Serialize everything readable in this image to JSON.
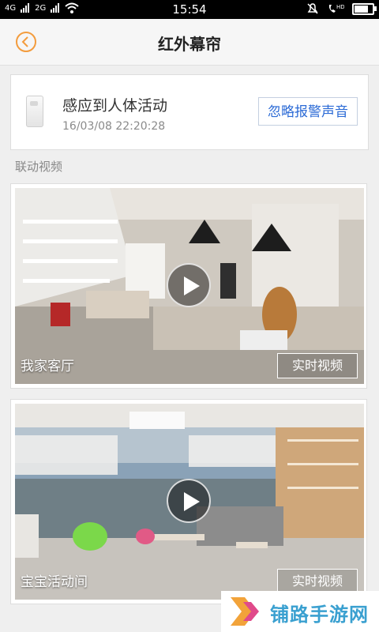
{
  "status_bar": {
    "signal_1": "4G",
    "signal_2": "2G",
    "time": "15:54",
    "battery_level": 0.85
  },
  "header": {
    "title": "红外幕帘"
  },
  "alert": {
    "title": "感应到人体活动",
    "time": "16/03/08 22:20:28",
    "mute_label": "忽略报警声音"
  },
  "section_label": "联动视频",
  "videos": [
    {
      "name": "我家客厅",
      "button": "实时视频"
    },
    {
      "name": "宝宝活动间",
      "button": "实时视频"
    }
  ],
  "watermark": {
    "text": "铺路手游网"
  },
  "colors": {
    "accent": "#f39c3d",
    "link": "#2c6bd6",
    "watermark": "#3aa0d0"
  }
}
